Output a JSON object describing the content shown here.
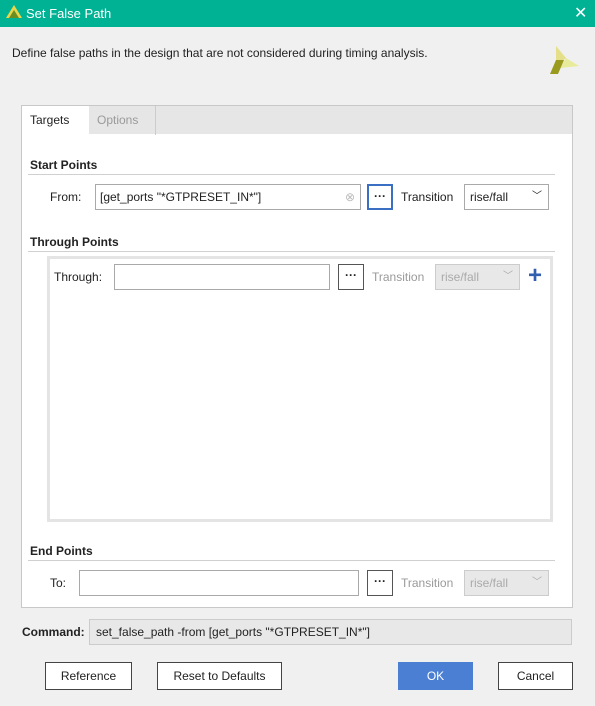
{
  "window": {
    "title": "Set False Path",
    "close_icon": "close-icon",
    "accent": "#00b294"
  },
  "description": "Define false paths in the design that are not considered during timing analysis.",
  "tabs": [
    {
      "label": "Targets",
      "active": true
    },
    {
      "label": "Options",
      "active": false
    }
  ],
  "start_points": {
    "heading": "Start Points",
    "from_label": "From:",
    "from_value": "[get_ports \"*GTPRESET_IN*\"]",
    "transition_label": "Transition",
    "transition_value": "rise/fall"
  },
  "through_points": {
    "heading": "Through Points",
    "through_label": "Through:",
    "through_value": "",
    "transition_label": "Transition",
    "transition_value": "rise/fall"
  },
  "end_points": {
    "heading": "End Points",
    "to_label": "To:",
    "to_value": "",
    "transition_label": "Transition",
    "transition_value": "rise/fall"
  },
  "browse_label": "···",
  "command": {
    "label": "Command:",
    "value": "set_false_path -from [get_ports \"*GTPRESET_IN*\"]"
  },
  "buttons": {
    "reference": "Reference",
    "reset": "Reset to Defaults",
    "ok": "OK",
    "cancel": "Cancel"
  }
}
